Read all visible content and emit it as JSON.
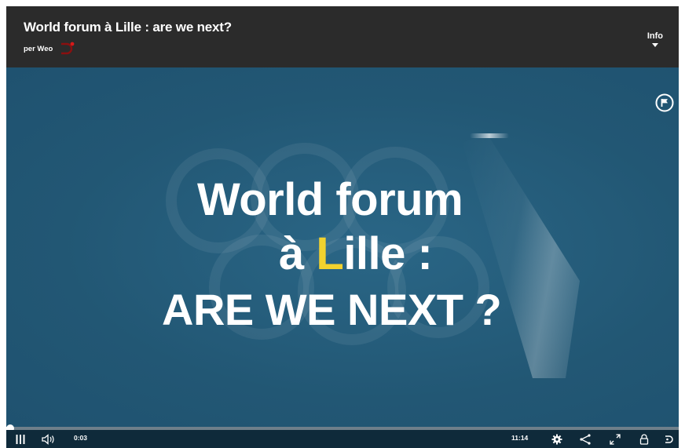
{
  "player": {
    "title": "World forum à Lille : are we next?",
    "byline": "per Weo",
    "info_label": "Info"
  },
  "video": {
    "headline_line1": "World forum",
    "headline_line2_prefix": "à ",
    "headline_line2_accent": "L",
    "headline_line2_suffix": "ille :",
    "headline_line3": "ARE WE NEXT ?",
    "accent_color": "#f2d22e",
    "background_color": "#245a77"
  },
  "controls": {
    "current_time": "0:03",
    "duration": "11:14",
    "progress_fraction": 0.004,
    "icons": {
      "play_pause": "pause-icon",
      "volume": "muted-speaker-icon",
      "settings": "gear-icon",
      "share": "share-icon",
      "fullscreen": "fullscreen-icon",
      "lock": "lock-icon",
      "logo": "weo-logo-icon",
      "report": "flag-icon"
    }
  }
}
